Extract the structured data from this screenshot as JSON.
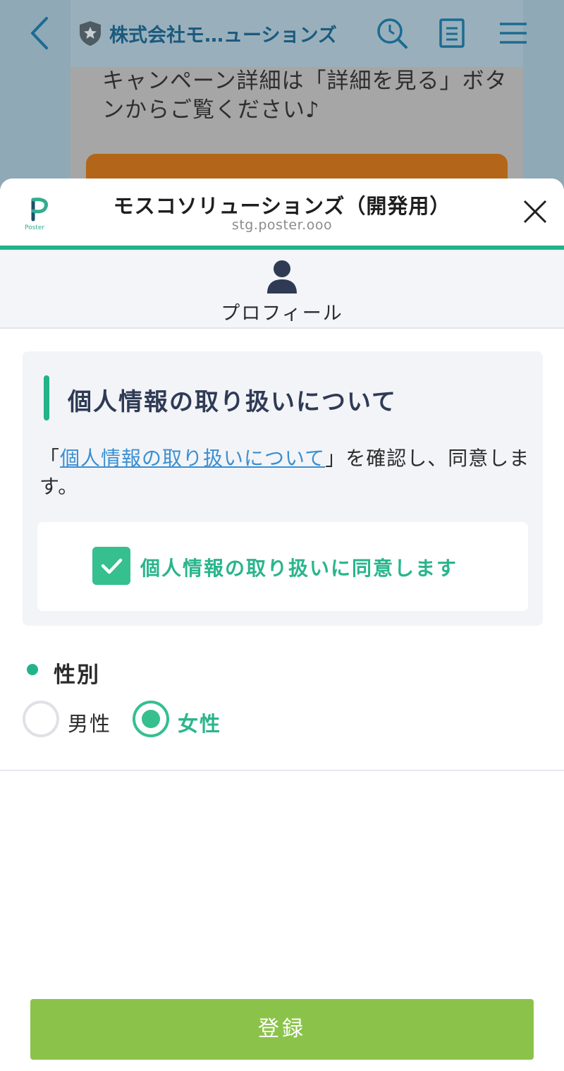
{
  "background_chat": {
    "header_title": "株式会社モ…ューションズ",
    "bubble_text": "キャンペーン詳細は「詳細を見る」ボタンからご覧ください♪"
  },
  "sheet": {
    "title": "モスコソリューションズ（開発用）",
    "url": "stg.poster.ooo",
    "logo_text": "Poster"
  },
  "profile_tab": {
    "label": "プロフィール"
  },
  "consent": {
    "heading": "個人情報の取り扱いについて",
    "text_prefix": "「",
    "link_text": "個人情報の取り扱いについて",
    "text_suffix": "」を確認し、同意します。",
    "checkbox_label": "個人情報の取り扱いに同意します",
    "checked": true
  },
  "gender": {
    "label": "性別",
    "options": [
      {
        "label": "男性",
        "selected": false
      },
      {
        "label": "女性",
        "selected": true
      }
    ]
  },
  "submit": {
    "label": "登録"
  },
  "colors": {
    "accent": "#22b38a",
    "submit_button": "#8bc34a",
    "link": "#3a8fd1",
    "background_overlay": "#8fa9b6"
  }
}
